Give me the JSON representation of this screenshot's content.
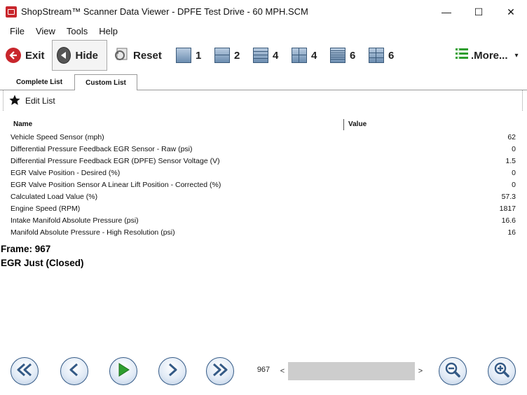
{
  "window": {
    "title": "ShopStream™ Scanner Data Viewer - DPFE Test Drive - 60 MPH.SCM",
    "controls": {
      "minimize": "—",
      "maximize": "☐",
      "close": "✕"
    }
  },
  "menu": [
    "File",
    "View",
    "Tools",
    "Help"
  ],
  "toolbar": {
    "exit": "Exit",
    "hide": "Hide",
    "reset": "Reset",
    "layouts": [
      "1",
      "2",
      "4",
      "4",
      "6",
      "6"
    ],
    "more": ".More...",
    "more_caret": "▾"
  },
  "tabs": [
    "Complete List",
    "Custom List"
  ],
  "active_tab": "Custom List",
  "edit_list": "Edit List",
  "table": {
    "headers": {
      "name": "Name",
      "value": "Value"
    },
    "rows": [
      {
        "name": "Vehicle Speed Sensor (mph)",
        "value": "62"
      },
      {
        "name": "Differential Pressure Feedback EGR Sensor - Raw (psi)",
        "value": "0"
      },
      {
        "name": "Differential Pressure Feedback EGR (DPFE) Sensor Voltage (V)",
        "value": "1.5"
      },
      {
        "name": "EGR Valve Position - Desired (%)",
        "value": "0"
      },
      {
        "name": "EGR Valve Position Sensor A Linear Lift Position - Corrected (%)",
        "value": "0"
      },
      {
        "name": "Calculated Load Value (%)",
        "value": "57.3"
      },
      {
        "name": "Engine Speed (RPM)",
        "value": "1817"
      },
      {
        "name": "Intake Manifold Absolute Pressure (psi)",
        "value": "16.6"
      },
      {
        "name": "Manifold Absolute Pressure - High Resolution (psi)",
        "value": "16"
      }
    ]
  },
  "info": {
    "frame": "Frame: 967",
    "status": "EGR Just (Closed)"
  },
  "playback": {
    "frame_number": "967",
    "scroll_left": "<",
    "scroll_right": ">"
  },
  "colors": {
    "accent_blue": "#345a86",
    "exit_red": "#c8262c",
    "play_green": "#2e9e2e"
  }
}
